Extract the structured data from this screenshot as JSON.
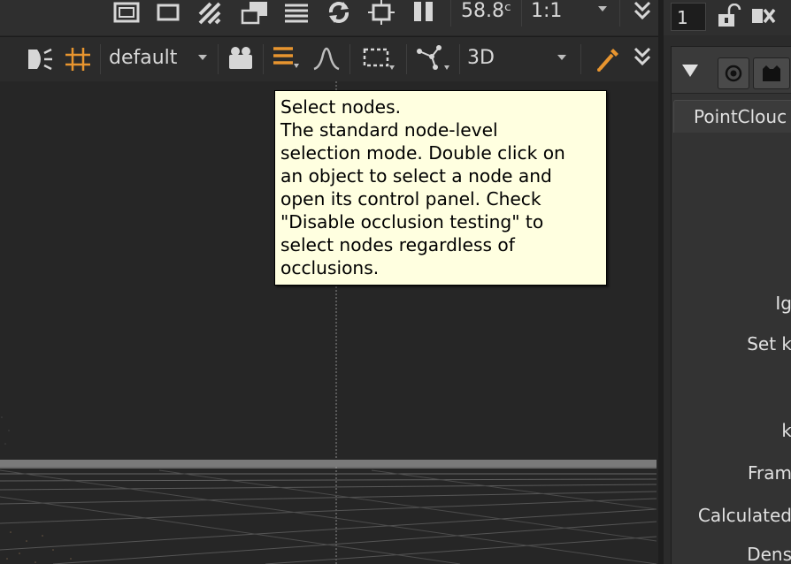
{
  "viewer": {
    "toolbar_top": {
      "fps": "58.8ᶜ",
      "zoom": "1:1"
    },
    "toolbar_second": {
      "layer_dropdown": "default",
      "view_mode": "3D"
    }
  },
  "tooltip": {
    "title": "Select nodes.",
    "body": "The standard node-level\nselection mode. Double click on\nan object to select a node and\nopen its control panel. Check\n\"Disable occlusion testing\" to\nselect nodes regardless of\nocclusions."
  },
  "right_panel": {
    "frame_value": "1",
    "tab_label": "PointClouc",
    "knobs": [
      "Ig",
      "Set k",
      "k",
      "Fram",
      "Calculated",
      "Dens"
    ]
  },
  "colors": {
    "accent": "#e8952f",
    "tooltip_bg": "#ffffe0"
  }
}
